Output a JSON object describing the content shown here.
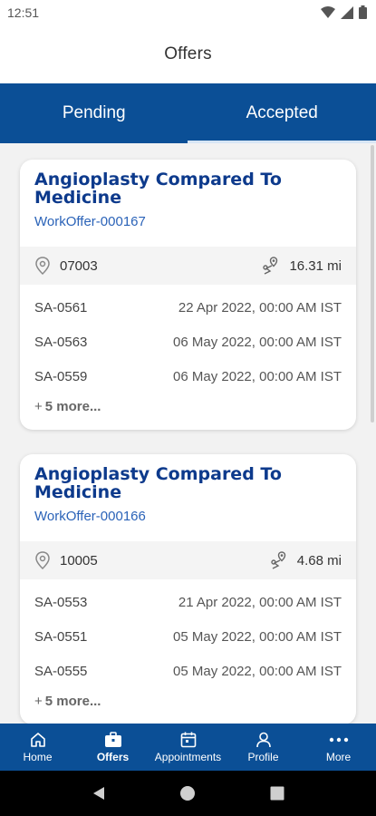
{
  "status_bar": {
    "time": "12:51"
  },
  "header": {
    "title": "Offers"
  },
  "tabs": [
    {
      "label": "Pending",
      "active": false
    },
    {
      "label": "Accepted",
      "active": true
    }
  ],
  "cards": [
    {
      "title_line1": "Angioplasty Compared To",
      "title_line2": "Medicine",
      "offer_id": "WorkOffer-000167",
      "zip": "07003",
      "distance": "16.31 mi",
      "appointments": [
        {
          "id": "SA-0561",
          "date": "22 Apr 2022, 00:00 AM IST"
        },
        {
          "id": "SA-0563",
          "date": "06 May 2022, 00:00 AM IST"
        },
        {
          "id": "SA-0559",
          "date": "06 May 2022, 00:00 AM IST"
        }
      ],
      "more_label": "5 more...",
      "more_prefix": "+"
    },
    {
      "title_line1": "Angioplasty Compared To",
      "title_line2": "Medicine",
      "offer_id": "WorkOffer-000166",
      "zip": "10005",
      "distance": "4.68 mi",
      "appointments": [
        {
          "id": "SA-0553",
          "date": "21 Apr 2022, 00:00 AM IST"
        },
        {
          "id": "SA-0551",
          "date": "05 May 2022, 00:00 AM IST"
        },
        {
          "id": "SA-0555",
          "date": "05 May 2022, 00:00 AM IST"
        }
      ],
      "more_label": "5 more...",
      "more_prefix": "+"
    }
  ],
  "bottom_nav": [
    {
      "label": "Home",
      "icon": "home-icon",
      "active": false
    },
    {
      "label": "Offers",
      "icon": "briefcase-icon",
      "active": true
    },
    {
      "label": "Appointments",
      "icon": "calendar-icon",
      "active": false
    },
    {
      "label": "Profile",
      "icon": "person-icon",
      "active": false
    },
    {
      "label": "More",
      "icon": "more-dots-icon",
      "active": false
    }
  ],
  "colors": {
    "primary": "#0b4f96",
    "title": "#0d3a8c",
    "link": "#2b63b8"
  }
}
